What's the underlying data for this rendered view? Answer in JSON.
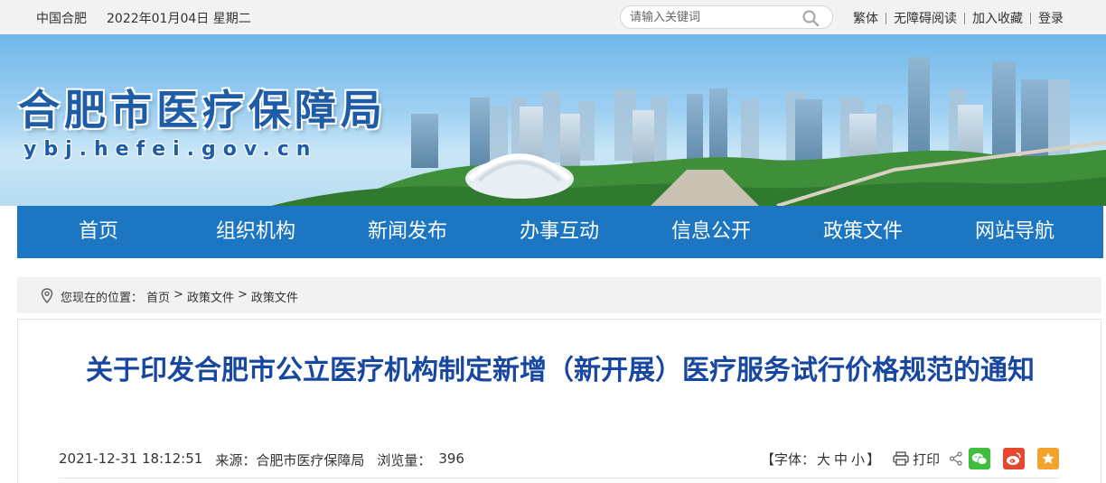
{
  "topbar": {
    "site_name": "中国合肥",
    "date": "2022年01月04日 星期二",
    "search_placeholder": "请输入关键词",
    "links": [
      "繁体",
      "无障碍阅读",
      "加入收藏",
      "登录"
    ]
  },
  "banner": {
    "title_cn": "合肥市医疗保障局",
    "title_en": "ybj.hefei.gov.cn"
  },
  "nav": {
    "items": [
      "首页",
      "组织机构",
      "新闻发布",
      "办事互动",
      "信息公开",
      "政策文件",
      "网站导航"
    ]
  },
  "breadcrumb": {
    "prefix": "您现在的位置：",
    "items": [
      "首页",
      "政策文件",
      "政策文件"
    ],
    "separator": ">"
  },
  "article": {
    "title": "关于印发合肥市公立医疗机构制定新增（新开展）医疗服务试行价格规范的通知",
    "datetime": "2021-12-31 18:12:51",
    "source": "来源：合肥市医疗保障局",
    "views_label": "浏览量：",
    "views": "396",
    "font_label_open": "【字体：",
    "font_large": "大",
    "font_medium": "中",
    "font_small": "小",
    "font_label_close": "】",
    "print_label": "打印"
  },
  "colors": {
    "nav_bg": "#1c76c2",
    "title_color": "#17479e",
    "wechat": "#3fbd3c",
    "weibo": "#e6472f",
    "favorite": "#f2a32b"
  }
}
